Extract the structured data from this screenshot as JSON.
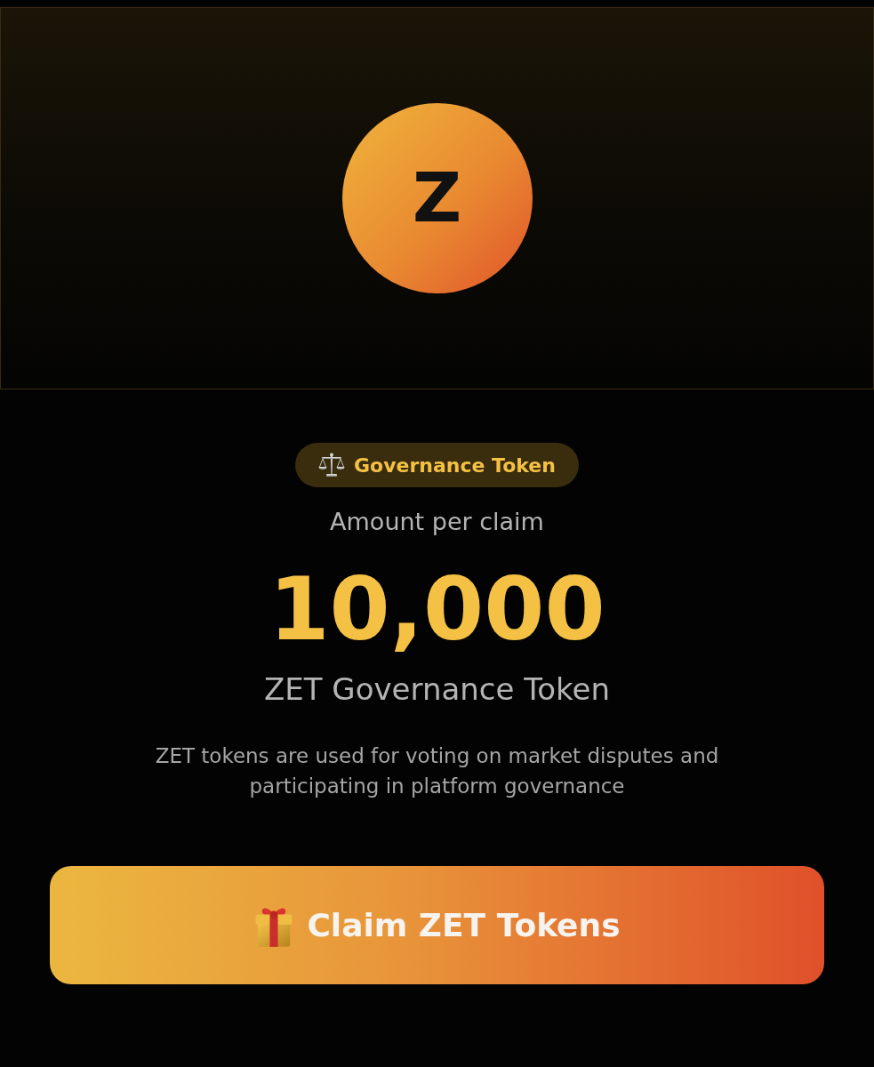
{
  "token": {
    "symbol": "Z"
  },
  "badge": {
    "label": "Governance Token"
  },
  "amount_label": "Amount per claim",
  "amount": "10,000",
  "token_name": "ZET Governance Token",
  "description": "ZET tokens are used for voting on market disputes and participating in platform governance",
  "claim_button": {
    "label": "Claim ZET Tokens"
  }
}
